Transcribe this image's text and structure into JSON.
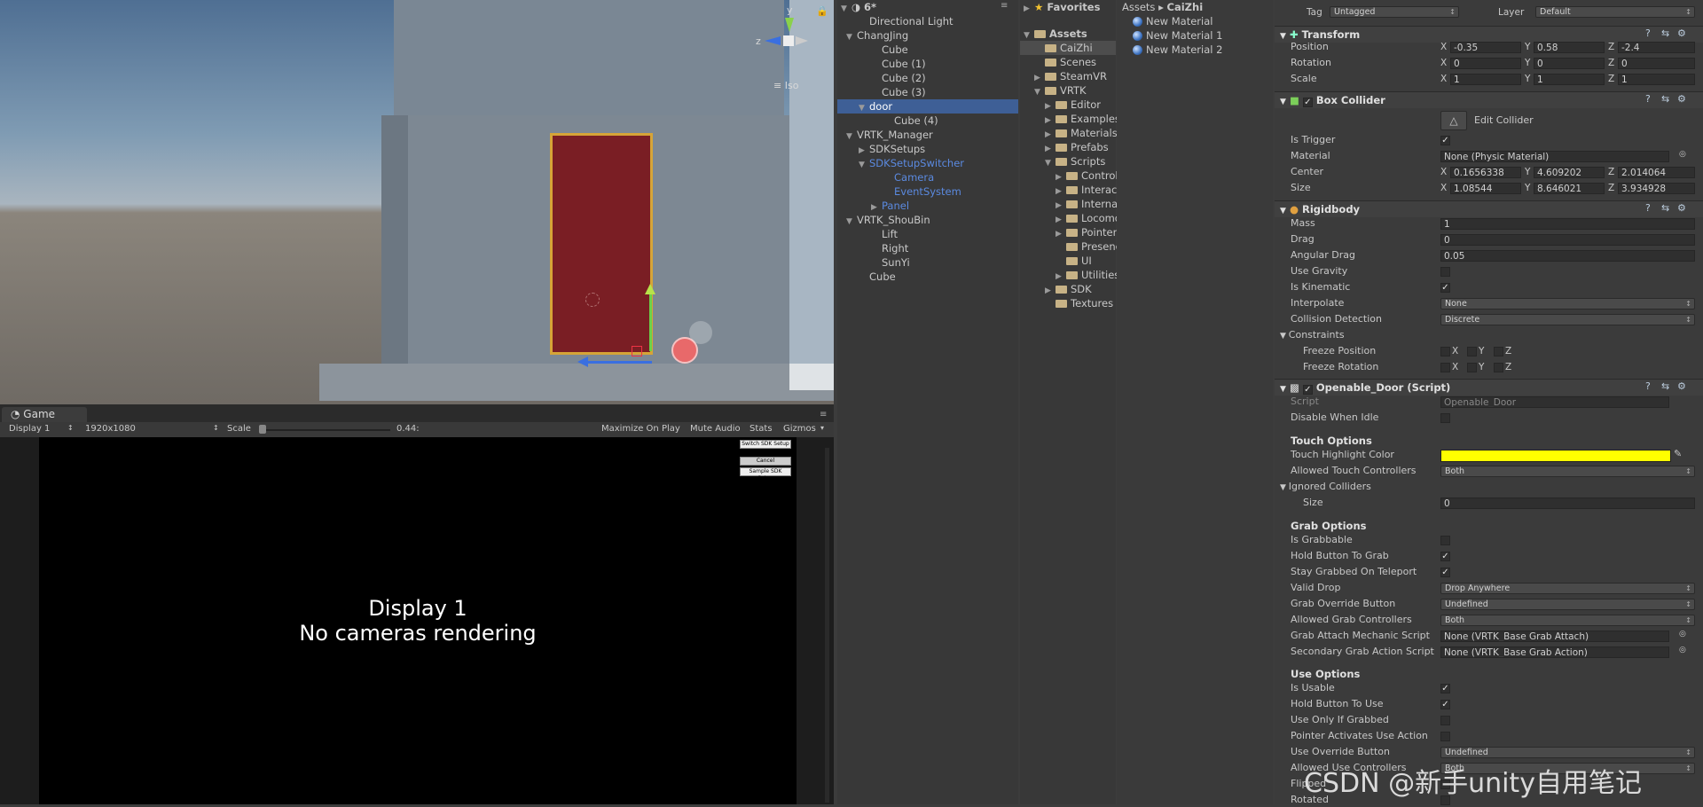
{
  "scene": {
    "iso_label": "≡ Iso",
    "gizmo_y": "y",
    "gizmo_z": "z"
  },
  "game": {
    "tab_label": "Game",
    "display": "Display 1",
    "resolution": "1920x1080",
    "scale_label": "Scale",
    "scale_value": "0.44:",
    "maximize": "Maximize On Play",
    "mute": "Mute Audio",
    "stats": "Stats",
    "gizmos": "Gizmos",
    "buttons": [
      "Switch SDK Setup",
      "Cancel",
      "Sample SDK Setup"
    ],
    "message_line1": "Display 1",
    "message_line2": "No cameras rendering"
  },
  "hierarchy": {
    "scene_name": "6*",
    "items": [
      {
        "label": "Directional Light",
        "depth": 1,
        "arrow": "",
        "state": ""
      },
      {
        "label": "ChangJing",
        "depth": 0,
        "arrow": "▼",
        "state": ""
      },
      {
        "label": "Cube",
        "depth": 2,
        "arrow": "",
        "state": ""
      },
      {
        "label": "Cube (1)",
        "depth": 2,
        "arrow": "",
        "state": ""
      },
      {
        "label": "Cube (2)",
        "depth": 2,
        "arrow": "",
        "state": ""
      },
      {
        "label": "Cube (3)",
        "depth": 2,
        "arrow": "",
        "state": ""
      },
      {
        "label": "door",
        "depth": 1,
        "arrow": "▼",
        "state": "sel"
      },
      {
        "label": "Cube (4)",
        "depth": 3,
        "arrow": "",
        "state": ""
      },
      {
        "label": "VRTK_Manager",
        "depth": 0,
        "arrow": "▼",
        "state": ""
      },
      {
        "label": "SDKSetups",
        "depth": 1,
        "arrow": "▶",
        "state": ""
      },
      {
        "label": "SDKSetupSwitcher",
        "depth": 1,
        "arrow": "▼",
        "state": "blue"
      },
      {
        "label": "Camera",
        "depth": 3,
        "arrow": "",
        "state": "blue"
      },
      {
        "label": "EventSystem",
        "depth": 3,
        "arrow": "",
        "state": "blue"
      },
      {
        "label": "Panel",
        "depth": 2,
        "arrow": "▶",
        "state": "blue"
      },
      {
        "label": "VRTK_ShouBin",
        "depth": 0,
        "arrow": "▼",
        "state": ""
      },
      {
        "label": "Lift",
        "depth": 2,
        "arrow": "",
        "state": ""
      },
      {
        "label": "Right",
        "depth": 2,
        "arrow": "",
        "state": ""
      },
      {
        "label": "SunYi",
        "depth": 2,
        "arrow": "",
        "state": ""
      },
      {
        "label": "Cube",
        "depth": 1,
        "arrow": "",
        "state": ""
      }
    ]
  },
  "project": {
    "favorites": "Favorites",
    "assets": "Assets",
    "breadcrumb_root": "Assets",
    "breadcrumb_sep": "▸",
    "breadcrumb_current": "CaiZhi",
    "folders": [
      {
        "label": "CaiZhi",
        "depth": 1,
        "arrow": "",
        "sel": true
      },
      {
        "label": "Scenes",
        "depth": 1,
        "arrow": "",
        "sel": false
      },
      {
        "label": "SteamVR",
        "depth": 1,
        "arrow": "▶",
        "sel": false
      },
      {
        "label": "VRTK",
        "depth": 1,
        "arrow": "▼",
        "sel": false
      },
      {
        "label": "Editor",
        "depth": 2,
        "arrow": "▶",
        "sel": false
      },
      {
        "label": "Examples",
        "depth": 2,
        "arrow": "▶",
        "sel": false
      },
      {
        "label": "Materials",
        "depth": 2,
        "arrow": "▶",
        "sel": false
      },
      {
        "label": "Prefabs",
        "depth": 2,
        "arrow": "▶",
        "sel": false
      },
      {
        "label": "Scripts",
        "depth": 2,
        "arrow": "▼",
        "sel": false
      },
      {
        "label": "Controls",
        "depth": 3,
        "arrow": "▶",
        "sel": false
      },
      {
        "label": "Interactions",
        "depth": 3,
        "arrow": "▶",
        "sel": false
      },
      {
        "label": "Internal",
        "depth": 3,
        "arrow": "▶",
        "sel": false
      },
      {
        "label": "Locomotion",
        "depth": 3,
        "arrow": "▶",
        "sel": false
      },
      {
        "label": "Pointers",
        "depth": 3,
        "arrow": "▶",
        "sel": false
      },
      {
        "label": "Presence",
        "depth": 3,
        "arrow": "",
        "sel": false
      },
      {
        "label": "UI",
        "depth": 3,
        "arrow": "",
        "sel": false
      },
      {
        "label": "Utilities",
        "depth": 3,
        "arrow": "▶",
        "sel": false
      },
      {
        "label": "SDK",
        "depth": 2,
        "arrow": "▶",
        "sel": false
      },
      {
        "label": "Textures",
        "depth": 2,
        "arrow": "",
        "sel": false
      }
    ],
    "files": [
      "New Material",
      "New Material 1",
      "New Material 2"
    ]
  },
  "inspector": {
    "tag_label": "Tag",
    "tag_value": "Untagged",
    "layer_label": "Layer",
    "layer_value": "Default",
    "transform": {
      "title": "Transform",
      "rows": [
        {
          "label": "Position",
          "x": "-0.35",
          "y": "0.58",
          "z": "-2.4"
        },
        {
          "label": "Rotation",
          "x": "0",
          "y": "0",
          "z": "0"
        },
        {
          "label": "Scale",
          "x": "1",
          "y": "1",
          "z": "1"
        }
      ]
    },
    "box_collider": {
      "title": "Box Collider",
      "edit_label": "Edit Collider",
      "is_trigger": "Is Trigger",
      "material_label": "Material",
      "material_value": "None (Physic Material)",
      "center_label": "Center",
      "center": {
        "x": "0.1656338",
        "y": "4.609202",
        "z": "2.014064"
      },
      "size_label": "Size",
      "size": {
        "x": "1.08544",
        "y": "8.646021",
        "z": "3.934928"
      }
    },
    "rigidbody": {
      "title": "Rigidbody",
      "mass_label": "Mass",
      "mass": "1",
      "drag_label": "Drag",
      "drag": "0",
      "angular_label": "Angular Drag",
      "angular": "0.05",
      "gravity_label": "Use Gravity",
      "kinematic_label": "Is Kinematic",
      "interp_label": "Interpolate",
      "interp_value": "None",
      "collision_label": "Collision Detection",
      "collision_value": "Discrete",
      "constraints_label": "Constraints",
      "freeze_pos": "Freeze Position",
      "freeze_rot": "Freeze Rotation",
      "axis_x": "X",
      "axis_y": "Y",
      "axis_z": "Z"
    },
    "script": {
      "title": "Openable_Door (Script)",
      "script_label": "Script",
      "script_value": "Openable_Door",
      "disable_idle": "Disable When Idle",
      "touch_header": "Touch Options",
      "highlight_label": "Touch Highlight Color",
      "highlight_color": "#ffff00",
      "allowed_touch_label": "Allowed Touch Controllers",
      "allowed_touch_value": "Both",
      "ignored_label": "Ignored Colliders",
      "ignored_size_label": "Size",
      "ignored_size": "0",
      "grab_header": "Grab Options",
      "is_grabbable": "Is Grabbable",
      "hold_grab": "Hold Button To Grab",
      "stay_grabbed": "Stay Grabbed On Teleport",
      "valid_drop_label": "Valid Drop",
      "valid_drop_value": "Drop Anywhere",
      "grab_override_label": "Grab Override Button",
      "grab_override_value": "Undefined",
      "allowed_grab_label": "Allowed Grab Controllers",
      "allowed_grab_value": "Both",
      "grab_attach_label": "Grab Attach Mechanic Script",
      "grab_attach_value": "None (VRTK_Base Grab Attach)",
      "secondary_label": "Secondary Grab Action Script",
      "secondary_value": "None (VRTK_Base Grab Action)",
      "use_header": "Use Options",
      "is_usable": "Is Usable",
      "hold_use": "Hold Button To Use",
      "use_only_grabbed": "Use Only If Grabbed",
      "pointer_use": "Pointer Activates Use Action",
      "use_override_label": "Use Override Button",
      "use_override_value": "Undefined",
      "allowed_use_label": "Allowed Use Controllers",
      "allowed_use_value": "Both",
      "flipped": "Flipped",
      "rotated": "Rotated"
    }
  },
  "watermark": "CSDN @新手unity自用笔记"
}
